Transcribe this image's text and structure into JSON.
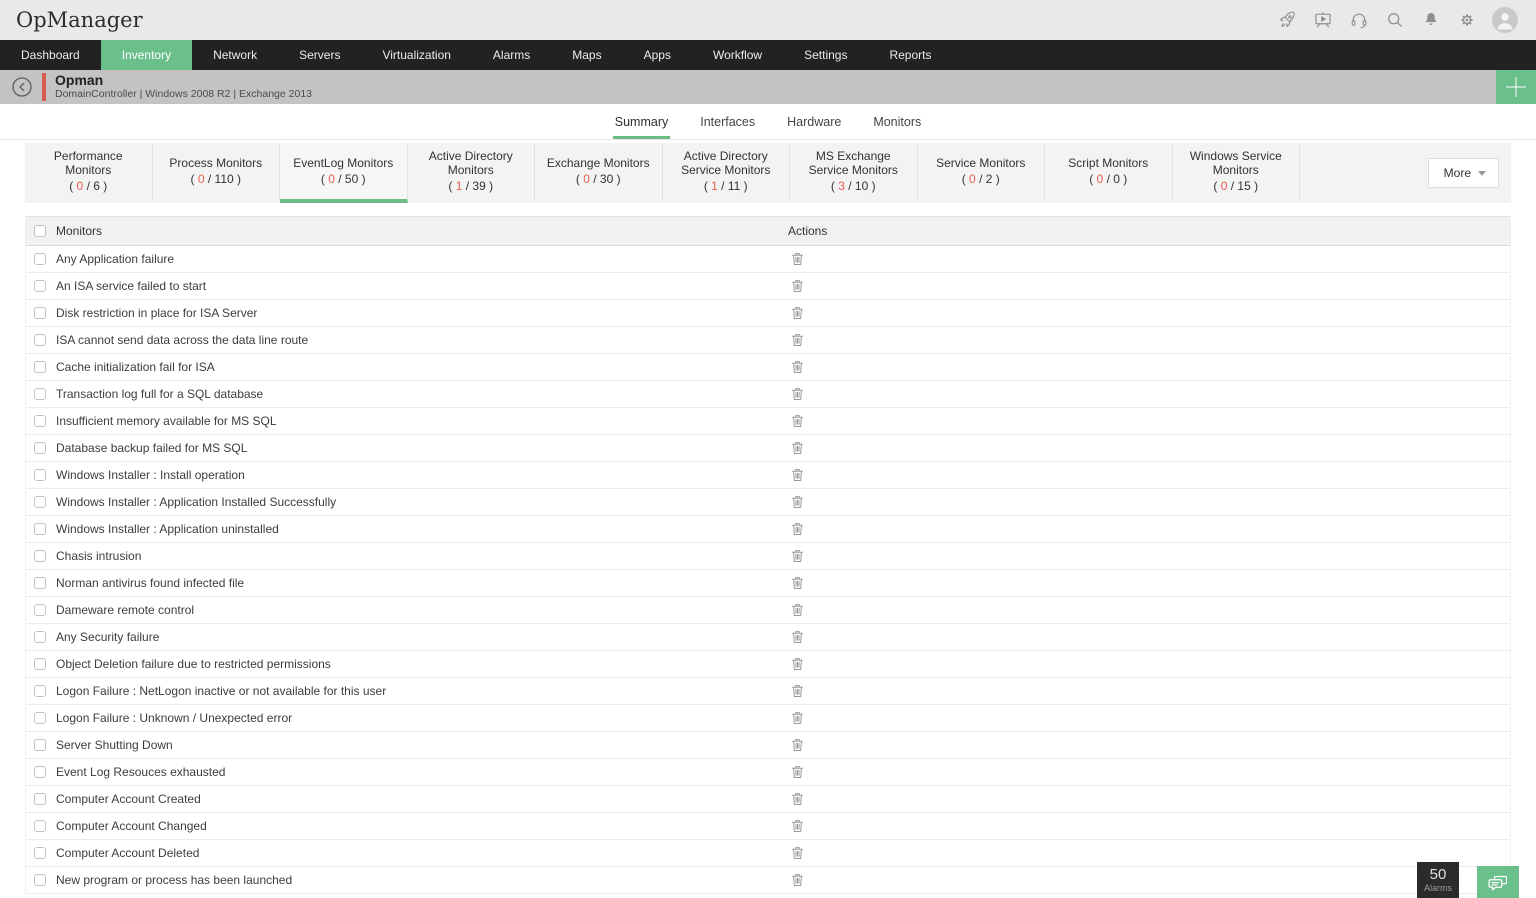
{
  "app": {
    "title": "OpManager"
  },
  "topbar": {
    "icons": [
      "rocket",
      "training-video",
      "support-headset",
      "search",
      "notifications-bell",
      "settings-gear",
      "user-avatar"
    ]
  },
  "nav": {
    "items": [
      {
        "label": "Dashboard",
        "active": false
      },
      {
        "label": "Inventory",
        "active": true
      },
      {
        "label": "Network",
        "active": false
      },
      {
        "label": "Servers",
        "active": false
      },
      {
        "label": "Virtualization",
        "active": false
      },
      {
        "label": "Alarms",
        "active": false
      },
      {
        "label": "Maps",
        "active": false
      },
      {
        "label": "Apps",
        "active": false
      },
      {
        "label": "Workflow",
        "active": false
      },
      {
        "label": "Settings",
        "active": false
      },
      {
        "label": "Reports",
        "active": false
      }
    ]
  },
  "device": {
    "name": "Opman",
    "subtitle": "DomainController | Windows 2008 R2  | Exchange 2013"
  },
  "page_tabs": [
    {
      "label": "Summary",
      "active": true
    },
    {
      "label": "Interfaces",
      "active": false
    },
    {
      "label": "Hardware",
      "active": false
    },
    {
      "label": "Monitors",
      "active": false
    }
  ],
  "monitor_tabs": [
    {
      "label": "Performance Monitors",
      "current": "0",
      "total": "6",
      "active": false
    },
    {
      "label": "Process Monitors",
      "current": "0",
      "total": "110",
      "active": false
    },
    {
      "label": "EventLog Monitors",
      "current": "0",
      "total": "50",
      "active": true
    },
    {
      "label": "Active Directory Monitors",
      "current": "1",
      "total": "39",
      "active": false
    },
    {
      "label": "Exchange Monitors",
      "current": "0",
      "total": "30",
      "active": false
    },
    {
      "label": "Active Directory Service Monitors",
      "current": "1",
      "total": "11",
      "active": false
    },
    {
      "label": "MS Exchange Service Monitors",
      "current": "3",
      "total": "10",
      "active": false
    },
    {
      "label": "Service Monitors",
      "current": "0",
      "total": "2",
      "active": false
    },
    {
      "label": "Script Monitors",
      "current": "0",
      "total": "0",
      "active": false
    },
    {
      "label": "Windows Service Monitors",
      "current": "0",
      "total": "15",
      "active": false
    }
  ],
  "more_button": {
    "label": "More"
  },
  "table": {
    "columns": {
      "monitors": "Monitors",
      "actions": "Actions"
    },
    "rows": [
      "Any Application failure",
      "An ISA service failed to start",
      "Disk restriction in place for ISA Server",
      "ISA cannot send data across the data line route",
      "Cache initialization fail for ISA",
      "Transaction log full for a SQL database",
      "Insufficient memory available for MS SQL",
      "Database backup failed for MS SQL",
      "Windows Installer : Install operation",
      "Windows Installer : Application Installed Successfully",
      "Windows Installer : Application uninstalled",
      "Chasis intrusion",
      "Norman antivirus found infected file",
      "Dameware remote control",
      "Any Security failure",
      "Object Deletion failure due to restricted permissions",
      "Logon Failure : NetLogon inactive or not available for this user",
      "Logon Failure : Unknown / Unexpected error",
      "Server Shutting Down",
      "Event Log Resouces exhausted",
      "Computer Account Created",
      "Computer Account Changed",
      "Computer Account Deleted",
      "New program or process has been launched"
    ]
  },
  "footer": {
    "alarm_count": "50",
    "alarm_label": "Alarms"
  },
  "colors": {
    "accent_green": "#6abf8b",
    "tab_underline_green": "#6cbd83",
    "alert_red": "#e8604c",
    "header_bar_red": "#d95a4e",
    "navbar_bg": "#222222",
    "device_header_bg": "#c3c3c3"
  }
}
